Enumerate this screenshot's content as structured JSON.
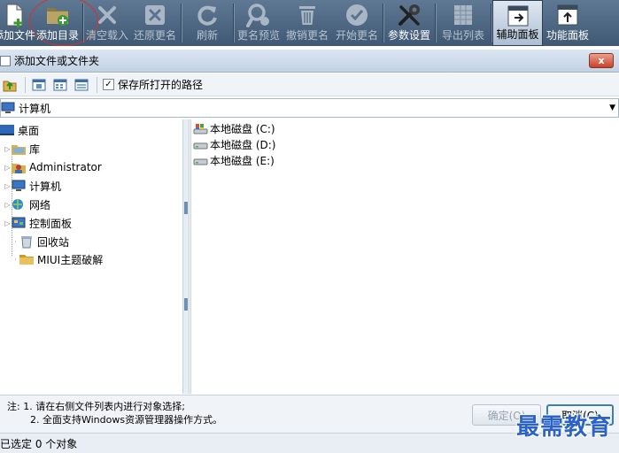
{
  "toolbar": {
    "buttons": [
      {
        "label": "添加文件",
        "icon": "add-file-icon",
        "state": "normal"
      },
      {
        "label": "添加目录",
        "icon": "add-folder-icon",
        "state": "normal"
      },
      {
        "label": "清空载入",
        "icon": "clear-x-icon",
        "state": "disabled"
      },
      {
        "label": "还原更名",
        "icon": "restore-x-icon",
        "state": "disabled"
      },
      {
        "label": "刷新",
        "icon": "refresh-icon",
        "state": "disabled"
      },
      {
        "label": "更名预览",
        "icon": "preview-search-icon",
        "state": "disabled"
      },
      {
        "label": "撤销更名",
        "icon": "undo-trash-icon",
        "state": "disabled"
      },
      {
        "label": "开始更名",
        "icon": "start-check-icon",
        "state": "disabled"
      },
      {
        "label": "参数设置",
        "icon": "settings-tools-icon",
        "state": "normal"
      },
      {
        "label": "导出列表",
        "icon": "export-list-icon",
        "state": "disabled"
      },
      {
        "label": "辅助面板",
        "icon": "aux-panel-icon",
        "state": "active"
      },
      {
        "label": "功能面板",
        "icon": "function-panel-icon",
        "state": "normal"
      }
    ]
  },
  "dialog": {
    "title": "添加文件或文件夹",
    "close_label": "x",
    "save_path_label": "保存所打开的路径",
    "save_path_checked": true,
    "path_value": "计算机",
    "tree": [
      {
        "label": "桌面",
        "icon": "desktop-icon",
        "expandable": false
      },
      {
        "label": "库",
        "icon": "library-icon",
        "expandable": true
      },
      {
        "label": "Administrator",
        "icon": "user-icon",
        "expandable": true
      },
      {
        "label": "计算机",
        "icon": "computer-icon",
        "expandable": true
      },
      {
        "label": "网络",
        "icon": "network-icon",
        "expandable": true
      },
      {
        "label": "控制面板",
        "icon": "control-panel-icon",
        "expandable": true
      },
      {
        "label": "回收站",
        "icon": "recycle-bin-icon",
        "expandable": false
      },
      {
        "label": "MIUI主题破解",
        "icon": "folder-icon",
        "expandable": false
      }
    ],
    "drives": [
      {
        "label": "本地磁盘 (C:)",
        "icon": "system-drive-icon"
      },
      {
        "label": "本地磁盘 (D:)",
        "icon": "drive-icon"
      },
      {
        "label": "本地磁盘 (E:)",
        "icon": "drive-icon"
      }
    ],
    "note_prefix": "注:",
    "note_lines": [
      "1. 请在右侧文件列表内进行对象选择;",
      "2. 全面支持Windows资源管理器操作方式。"
    ],
    "ok_label": "确定(O)",
    "cancel_label": "取消(C)",
    "status": "已选定 0 个对象"
  },
  "watermark": "最需教育",
  "colors": {
    "toolbar_bg": "#4c6580",
    "annotation_red": "#d9302a",
    "watermark_blue": "#2a62c8"
  }
}
